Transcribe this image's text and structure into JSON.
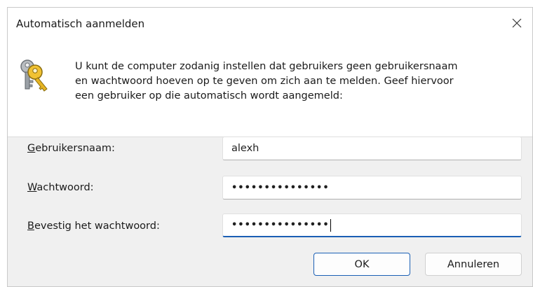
{
  "window": {
    "title": "Automatisch aanmelden"
  },
  "description": "U kunt de computer zodanig instellen dat gebruikers geen gebruikersnaam\nen wachtwoord hoeven op te geven om zich aan te melden. Geef hiervoor\neen gebruiker op die automatisch wordt aangemeld:",
  "form": {
    "username": {
      "label_accel": "G",
      "label_rest": "ebruikersnaam:",
      "value": "alexh"
    },
    "password": {
      "label_accel": "W",
      "label_rest": "achtwoord:",
      "value": "•••••••••••••••"
    },
    "confirm": {
      "label_accel": "B",
      "label_rest": "evestig het wachtwoord:",
      "value": "•••••••••••••••"
    }
  },
  "buttons": {
    "ok": "OK",
    "cancel": "Annuleren"
  },
  "icons": {
    "close": "close-icon",
    "keys": "keys-icon"
  },
  "colors": {
    "accent": "#1a5fb4",
    "dialog_bg": "#f0f0f0"
  }
}
